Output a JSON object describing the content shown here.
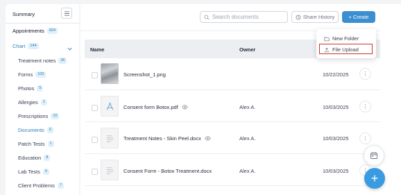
{
  "sidebar": {
    "summary_label": "Summary",
    "appointments": {
      "label": "Appointments",
      "count": "604"
    },
    "chart": {
      "label": "Chart",
      "count": "144"
    },
    "items": [
      {
        "label": "Treatment notes",
        "count": "36"
      },
      {
        "label": "Forms",
        "count": "100"
      },
      {
        "label": "Photos",
        "count": "5"
      },
      {
        "label": "Allergies",
        "count": "1"
      },
      {
        "label": "Prescriptions",
        "count": "10"
      },
      {
        "label": "Documents",
        "count": "6"
      },
      {
        "label": "Patch Tests",
        "count": "1"
      },
      {
        "label": "Education",
        "count": "8"
      },
      {
        "label": "Lab Tests",
        "count": "6"
      },
      {
        "label": "Client Problems",
        "count": "7"
      }
    ]
  },
  "toolbar": {
    "search_placeholder": "Search documents",
    "history_label": "Share History",
    "create_label": "+ Create"
  },
  "create_menu": {
    "items": [
      {
        "label": "New Folder",
        "icon": "folder-icon"
      },
      {
        "label": "File Upload",
        "icon": "upload-icon"
      }
    ]
  },
  "table": {
    "columns": [
      "Name",
      "Owner"
    ],
    "rows": [
      {
        "name": "Screenshot_1.png",
        "owner": "",
        "date": "10/22/2025",
        "thumb": "image"
      },
      {
        "name": "Consent form Botox.pdf",
        "owner": "Alex A.",
        "date": "10/03/2025",
        "thumb": "pdf"
      },
      {
        "name": "Treatment Notes - Skin Peel.docx",
        "owner": "Alex A.",
        "date": "10/03/2025",
        "thumb": "doc"
      },
      {
        "name": "Consent Form - Botox Treatment.docx",
        "owner": "Alex A.",
        "date": "10/03/2025",
        "thumb": "doc"
      }
    ]
  },
  "colors": {
    "accent": "#3b8fd0",
    "badge_bg": "#e0f0fa",
    "highlight": "#d32f2f"
  }
}
